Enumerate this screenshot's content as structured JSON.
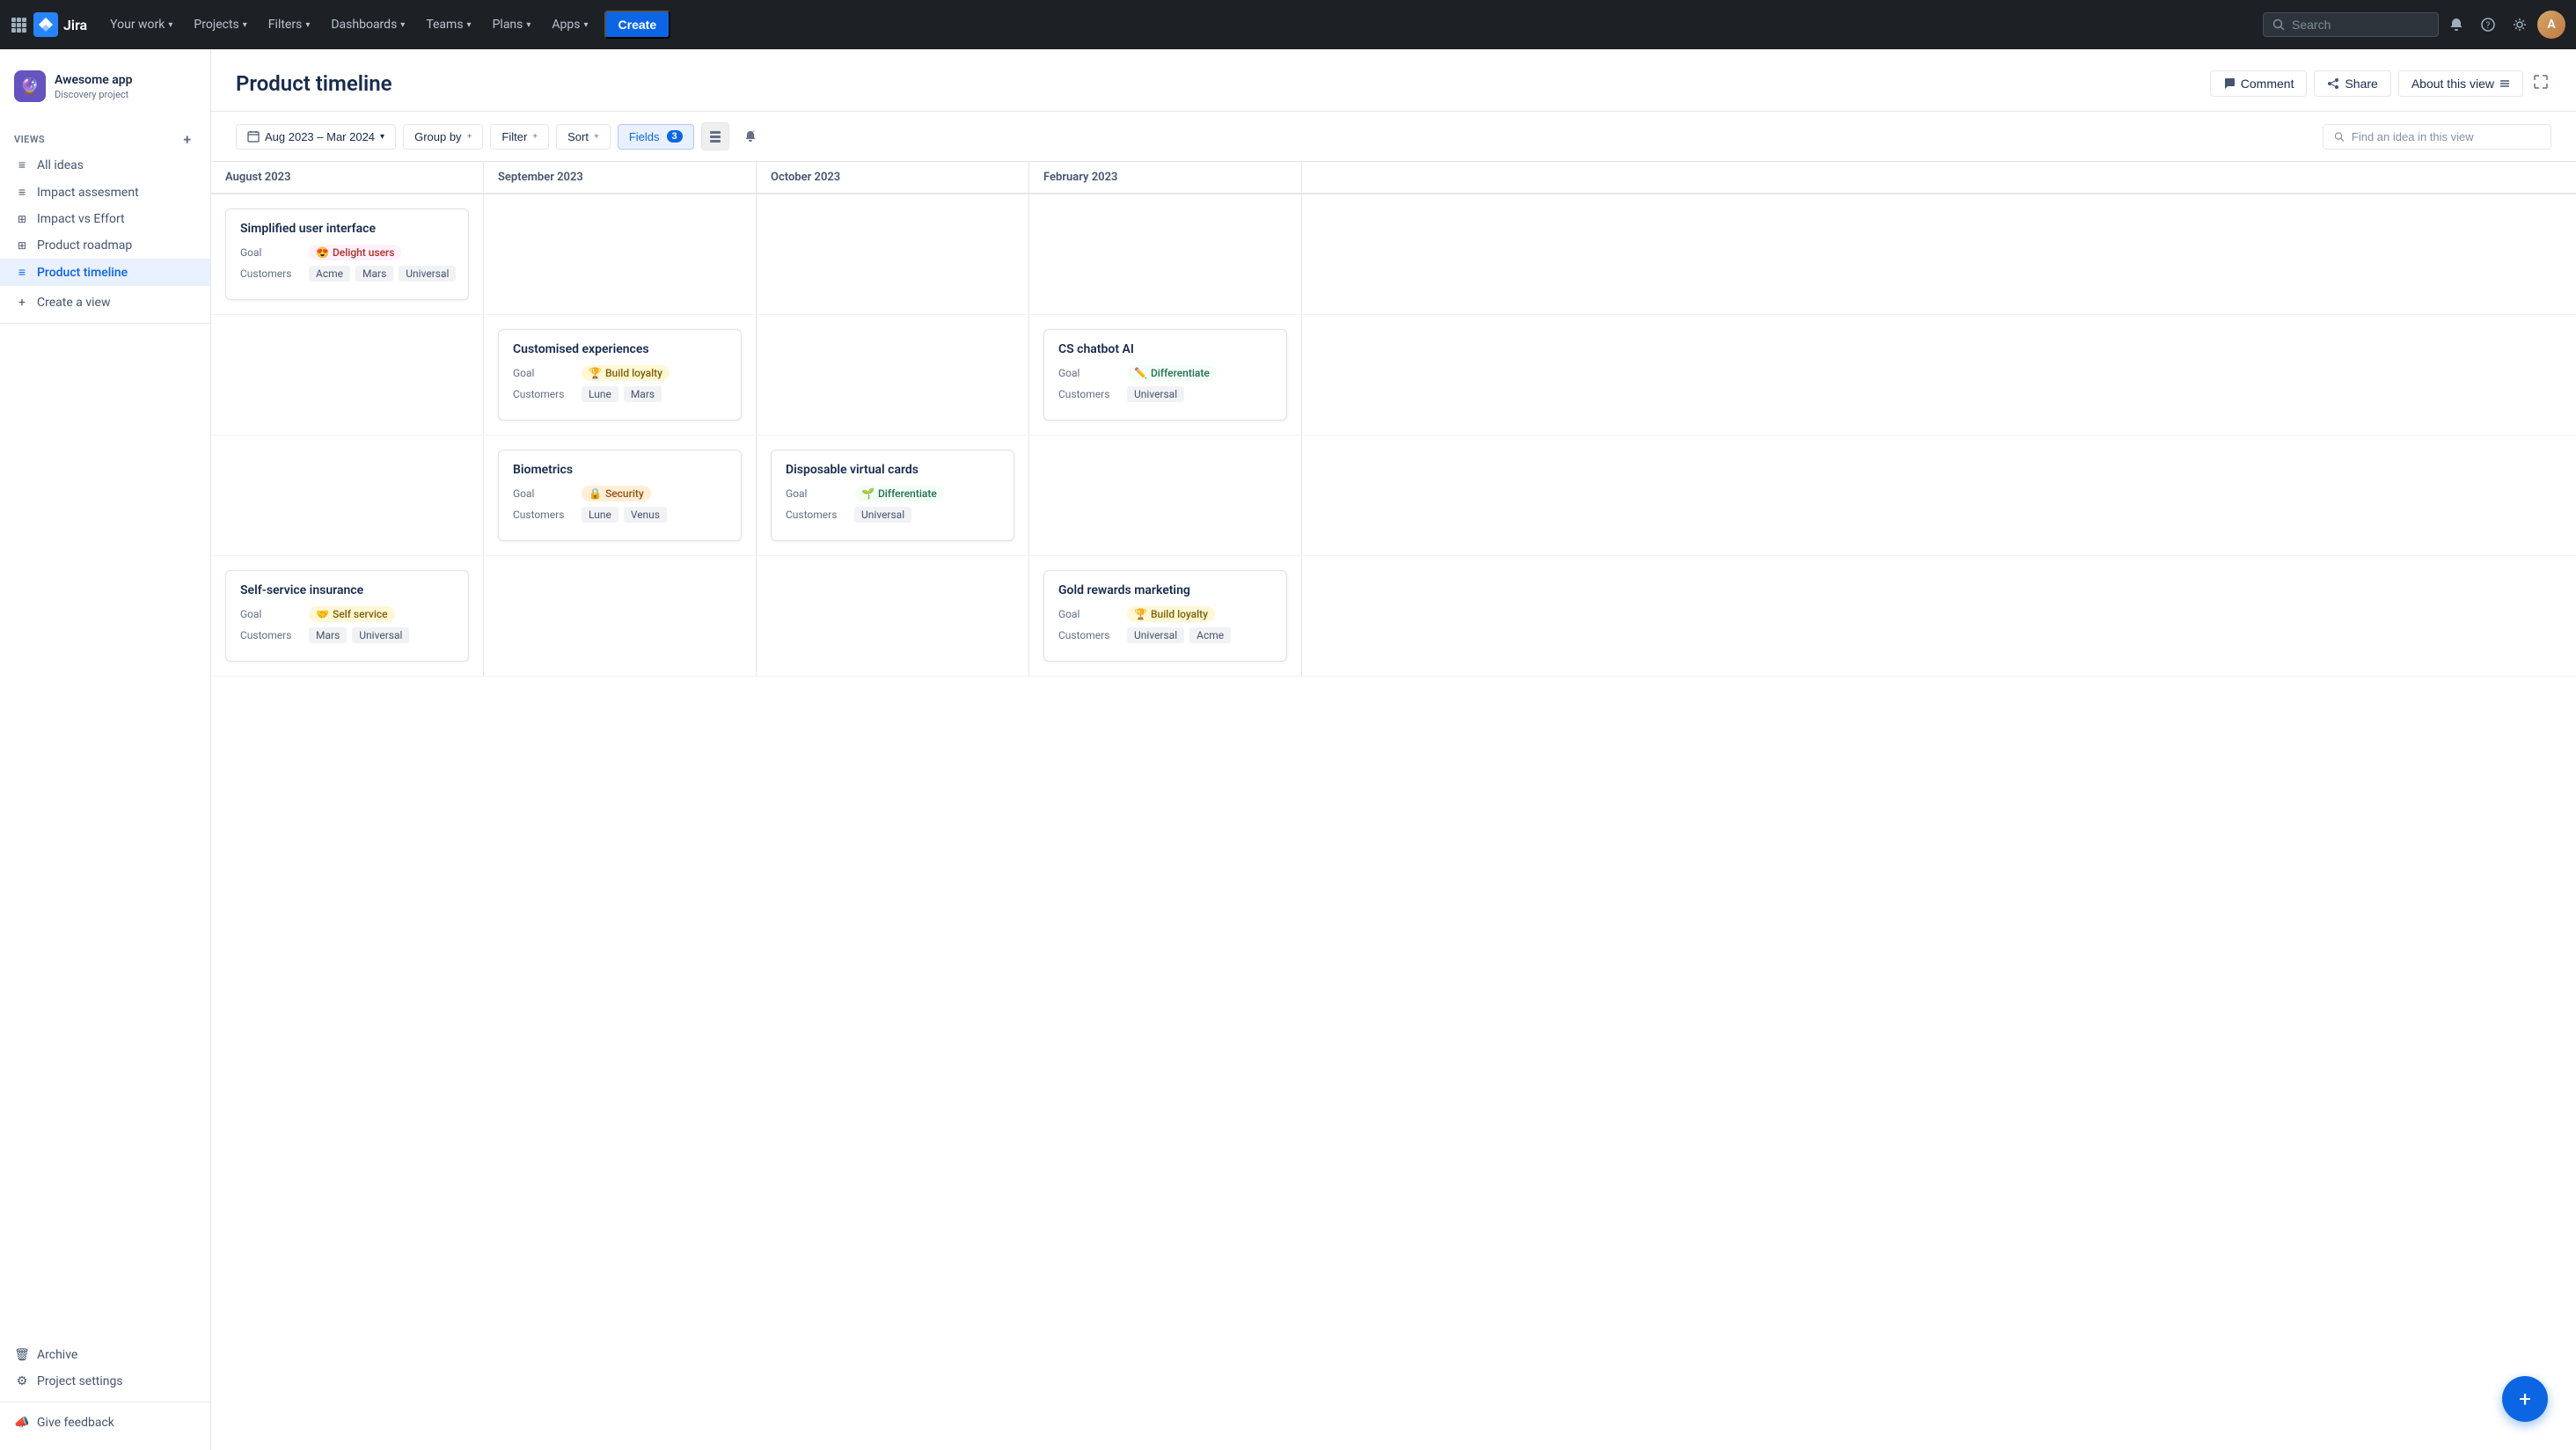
{
  "nav": {
    "apps_icon": "⊞",
    "logo_text": "Jira",
    "items": [
      {
        "label": "Your work",
        "id": "your-work"
      },
      {
        "label": "Projects",
        "id": "projects"
      },
      {
        "label": "Filters",
        "id": "filters"
      },
      {
        "label": "Dashboards",
        "id": "dashboards"
      },
      {
        "label": "Teams",
        "id": "teams"
      },
      {
        "label": "Plans",
        "id": "plans"
      },
      {
        "label": "Apps",
        "id": "apps"
      }
    ],
    "create_label": "Create",
    "search_placeholder": "Search"
  },
  "sidebar": {
    "project_name": "Awesome app",
    "project_type": "Discovery project",
    "views_label": "VIEWS",
    "views": [
      {
        "label": "All ideas",
        "icon": "≡",
        "id": "all-ideas"
      },
      {
        "label": "Impact assesment",
        "icon": "≡",
        "id": "impact-assessment"
      },
      {
        "label": "Impact vs Effort",
        "icon": "⊞",
        "id": "impact-effort"
      },
      {
        "label": "Product roadmap",
        "icon": "⊞",
        "id": "product-roadmap"
      },
      {
        "label": "Product timeline",
        "icon": "≡",
        "id": "product-timeline",
        "active": true
      }
    ],
    "create_view_label": "Create a view",
    "archive_label": "Archive",
    "settings_label": "Project settings",
    "feedback_label": "Give feedback"
  },
  "page": {
    "title": "Product timeline",
    "comment_btn": "Comment",
    "share_btn": "Share",
    "about_btn": "About this view"
  },
  "toolbar": {
    "date_range": "Aug 2023 – Mar 2024",
    "group_by": "Group by",
    "filter": "Filter",
    "sort": "Sort",
    "fields": "Fields",
    "fields_count": "3",
    "search_placeholder": "Find an idea in this view"
  },
  "timeline": {
    "months": [
      "August 2023",
      "September 2023",
      "October 2023",
      "February 2023"
    ]
  },
  "cards": {
    "row1": {
      "title": "Simplified user interface",
      "goal_label": "Goal",
      "goal_icon": "😍",
      "goal_text": "Delight users",
      "goal_class": "goal-delight",
      "customers_label": "Customers",
      "customers": [
        "Acme",
        "Mars",
        "Universal"
      ]
    },
    "row2a": {
      "title": "Customised experiences",
      "goal_label": "Goal",
      "goal_icon": "🏆",
      "goal_text": "Build loyalty",
      "goal_class": "goal-loyalty",
      "customers_label": "Customers",
      "customers": [
        "Lune",
        "Mars"
      ]
    },
    "row2b": {
      "title": "CS chatbot AI",
      "goal_label": "Goal",
      "goal_icon": "✏️",
      "goal_text": "Differentiate",
      "goal_class": "goal-differentiate",
      "customers_label": "Customers",
      "customers": [
        "Universal"
      ]
    },
    "row3a": {
      "title": "Biometrics",
      "goal_label": "Goal",
      "goal_icon": "🔒",
      "goal_text": "Security",
      "goal_class": "goal-security",
      "customers_label": "Customers",
      "customers": [
        "Lune",
        "Venus"
      ]
    },
    "row3b": {
      "title": "Disposable virtual cards",
      "goal_label": "Goal",
      "goal_icon": "🌱",
      "goal_text": "Differentiate",
      "goal_class": "goal-differentiate",
      "customers_label": "Customers",
      "customers": [
        "Universal"
      ]
    },
    "row4": {
      "title": "Self-service insurance",
      "goal_label": "Goal",
      "goal_icon": "🤝",
      "goal_text": "Self service",
      "goal_class": "goal-selfservice",
      "customers_label": "Customers",
      "customers": [
        "Mars",
        "Universal"
      ]
    },
    "row5": {
      "title": "Gold rewards marketing",
      "goal_label": "Goal",
      "goal_icon": "🏆",
      "goal_text": "Build loyalty",
      "goal_class": "goal-loyalty",
      "customers_label": "Customers",
      "customers": [
        "Universal",
        "Acme"
      ]
    }
  },
  "fab": {
    "icon": "+"
  }
}
